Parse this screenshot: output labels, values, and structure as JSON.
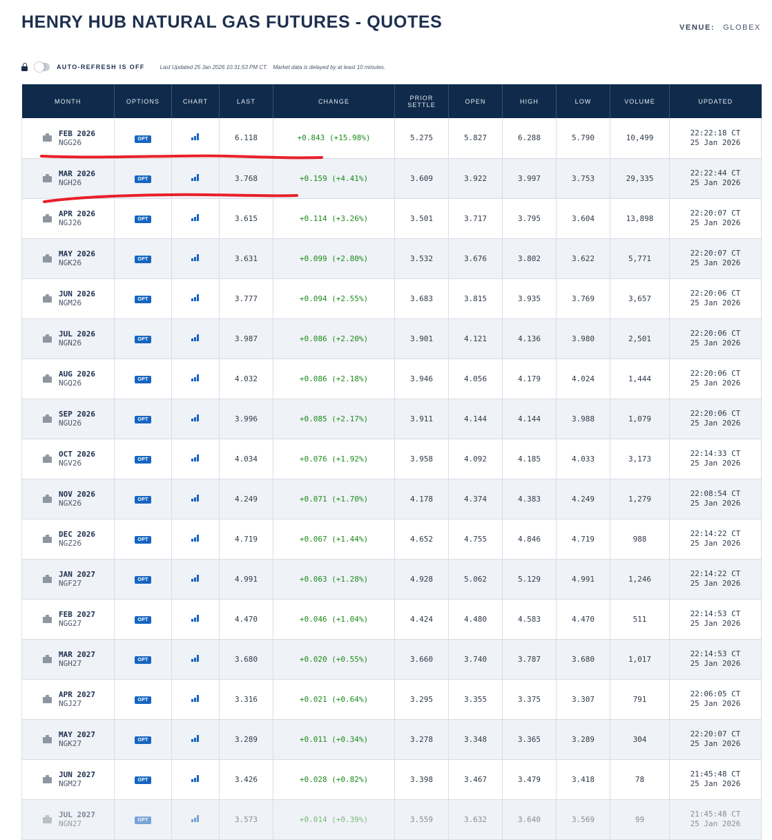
{
  "page": {
    "title": "HENRY HUB NATURAL GAS FUTURES - QUOTES",
    "venue_label": "VENUE:",
    "venue_value": "GLOBEX"
  },
  "refresh": {
    "toggle_label": "AUTO-REFRESH IS OFF",
    "last_updated": "Last Updated 25 Jan 2026 10:31:53 PM CT.",
    "delay_note": "Market data is delayed by at least 10 minutes."
  },
  "table": {
    "headers": [
      "MONTH",
      "OPTIONS",
      "CHART",
      "LAST",
      "CHANGE",
      "PRIOR SETTLE",
      "OPEN",
      "HIGH",
      "LOW",
      "VOLUME",
      "UPDATED"
    ],
    "opt_label": "OPT",
    "rows": [
      {
        "month": "FEB 2026",
        "code": "NGG26",
        "last": "6.118",
        "change": "+0.843 (+15.98%)",
        "prior": "5.275",
        "open": "5.827",
        "high": "6.288",
        "low": "5.790",
        "volume": "10,499",
        "time": "22:22:18 CT",
        "date": "25 Jan 2026"
      },
      {
        "month": "MAR 2026",
        "code": "NGH26",
        "last": "3.768",
        "change": "+0.159 (+4.41%)",
        "prior": "3.609",
        "open": "3.922",
        "high": "3.997",
        "low": "3.753",
        "volume": "29,335",
        "time": "22:22:44 CT",
        "date": "25 Jan 2026"
      },
      {
        "month": "APR 2026",
        "code": "NGJ26",
        "last": "3.615",
        "change": "+0.114 (+3.26%)",
        "prior": "3.501",
        "open": "3.717",
        "high": "3.795",
        "low": "3.604",
        "volume": "13,898",
        "time": "22:20:07 CT",
        "date": "25 Jan 2026"
      },
      {
        "month": "MAY 2026",
        "code": "NGK26",
        "last": "3.631",
        "change": "+0.099 (+2.80%)",
        "prior": "3.532",
        "open": "3.676",
        "high": "3.802",
        "low": "3.622",
        "volume": "5,771",
        "time": "22:20:07 CT",
        "date": "25 Jan 2026"
      },
      {
        "month": "JUN 2026",
        "code": "NGM26",
        "last": "3.777",
        "change": "+0.094 (+2.55%)",
        "prior": "3.683",
        "open": "3.815",
        "high": "3.935",
        "low": "3.769",
        "volume": "3,657",
        "time": "22:20:06 CT",
        "date": "25 Jan 2026"
      },
      {
        "month": "JUL 2026",
        "code": "NGN26",
        "last": "3.987",
        "change": "+0.086 (+2.20%)",
        "prior": "3.901",
        "open": "4.121",
        "high": "4.136",
        "low": "3.980",
        "volume": "2,501",
        "time": "22:20:06 CT",
        "date": "25 Jan 2026"
      },
      {
        "month": "AUG 2026",
        "code": "NGQ26",
        "last": "4.032",
        "change": "+0.086 (+2.18%)",
        "prior": "3.946",
        "open": "4.056",
        "high": "4.179",
        "low": "4.024",
        "volume": "1,444",
        "time": "22:20:06 CT",
        "date": "25 Jan 2026"
      },
      {
        "month": "SEP 2026",
        "code": "NGU26",
        "last": "3.996",
        "change": "+0.085 (+2.17%)",
        "prior": "3.911",
        "open": "4.144",
        "high": "4.144",
        "low": "3.988",
        "volume": "1,079",
        "time": "22:20:06 CT",
        "date": "25 Jan 2026"
      },
      {
        "month": "OCT 2026",
        "code": "NGV26",
        "last": "4.034",
        "change": "+0.076 (+1.92%)",
        "prior": "3.958",
        "open": "4.092",
        "high": "4.185",
        "low": "4.033",
        "volume": "3,173",
        "time": "22:14:33 CT",
        "date": "25 Jan 2026"
      },
      {
        "month": "NOV 2026",
        "code": "NGX26",
        "last": "4.249",
        "change": "+0.071 (+1.70%)",
        "prior": "4.178",
        "open": "4.374",
        "high": "4.383",
        "low": "4.249",
        "volume": "1,279",
        "time": "22:08:54 CT",
        "date": "25 Jan 2026"
      },
      {
        "month": "DEC 2026",
        "code": "NGZ26",
        "last": "4.719",
        "change": "+0.067 (+1.44%)",
        "prior": "4.652",
        "open": "4.755",
        "high": "4.846",
        "low": "4.719",
        "volume": "988",
        "time": "22:14:22 CT",
        "date": "25 Jan 2026"
      },
      {
        "month": "JAN 2027",
        "code": "NGF27",
        "last": "4.991",
        "change": "+0.063 (+1.28%)",
        "prior": "4.928",
        "open": "5.062",
        "high": "5.129",
        "low": "4.991",
        "volume": "1,246",
        "time": "22:14:22 CT",
        "date": "25 Jan 2026"
      },
      {
        "month": "FEB 2027",
        "code": "NGG27",
        "last": "4.470",
        "change": "+0.046 (+1.04%)",
        "prior": "4.424",
        "open": "4.480",
        "high": "4.583",
        "low": "4.470",
        "volume": "511",
        "time": "22:14:53 CT",
        "date": "25 Jan 2026"
      },
      {
        "month": "MAR 2027",
        "code": "NGH27",
        "last": "3.680",
        "change": "+0.020 (+0.55%)",
        "prior": "3.660",
        "open": "3.740",
        "high": "3.787",
        "low": "3.680",
        "volume": "1,017",
        "time": "22:14:53 CT",
        "date": "25 Jan 2026"
      },
      {
        "month": "APR 2027",
        "code": "NGJ27",
        "last": "3.316",
        "change": "+0.021 (+0.64%)",
        "prior": "3.295",
        "open": "3.355",
        "high": "3.375",
        "low": "3.307",
        "volume": "791",
        "time": "22:06:05 CT",
        "date": "25 Jan 2026"
      },
      {
        "month": "MAY 2027",
        "code": "NGK27",
        "last": "3.289",
        "change": "+0.011 (+0.34%)",
        "prior": "3.278",
        "open": "3.348",
        "high": "3.365",
        "low": "3.289",
        "volume": "304",
        "time": "22:20:07 CT",
        "date": "25 Jan 2026"
      },
      {
        "month": "JUN 2027",
        "code": "NGM27",
        "last": "3.426",
        "change": "+0.028 (+0.82%)",
        "prior": "3.398",
        "open": "3.467",
        "high": "3.479",
        "low": "3.418",
        "volume": "78",
        "time": "21:45:48 CT",
        "date": "25 Jan 2026"
      },
      {
        "month": "JUL 2027",
        "code": "NGN27",
        "last": "3.573",
        "change": "+0.014 (+0.39%)",
        "prior": "3.559",
        "open": "3.632",
        "high": "3.640",
        "low": "3.569",
        "volume": "99",
        "time": "21:45:48 CT",
        "date": "25 Jan 2026"
      }
    ]
  },
  "colors": {
    "header_bg": "#0f2a4b",
    "positive_change": "#1a8a1a",
    "opt_badge": "#1565c0",
    "annotation_marker": "#e8202a"
  },
  "annotations": {
    "underlined_rows": [
      "FEB 2026",
      "MAR 2026"
    ]
  }
}
